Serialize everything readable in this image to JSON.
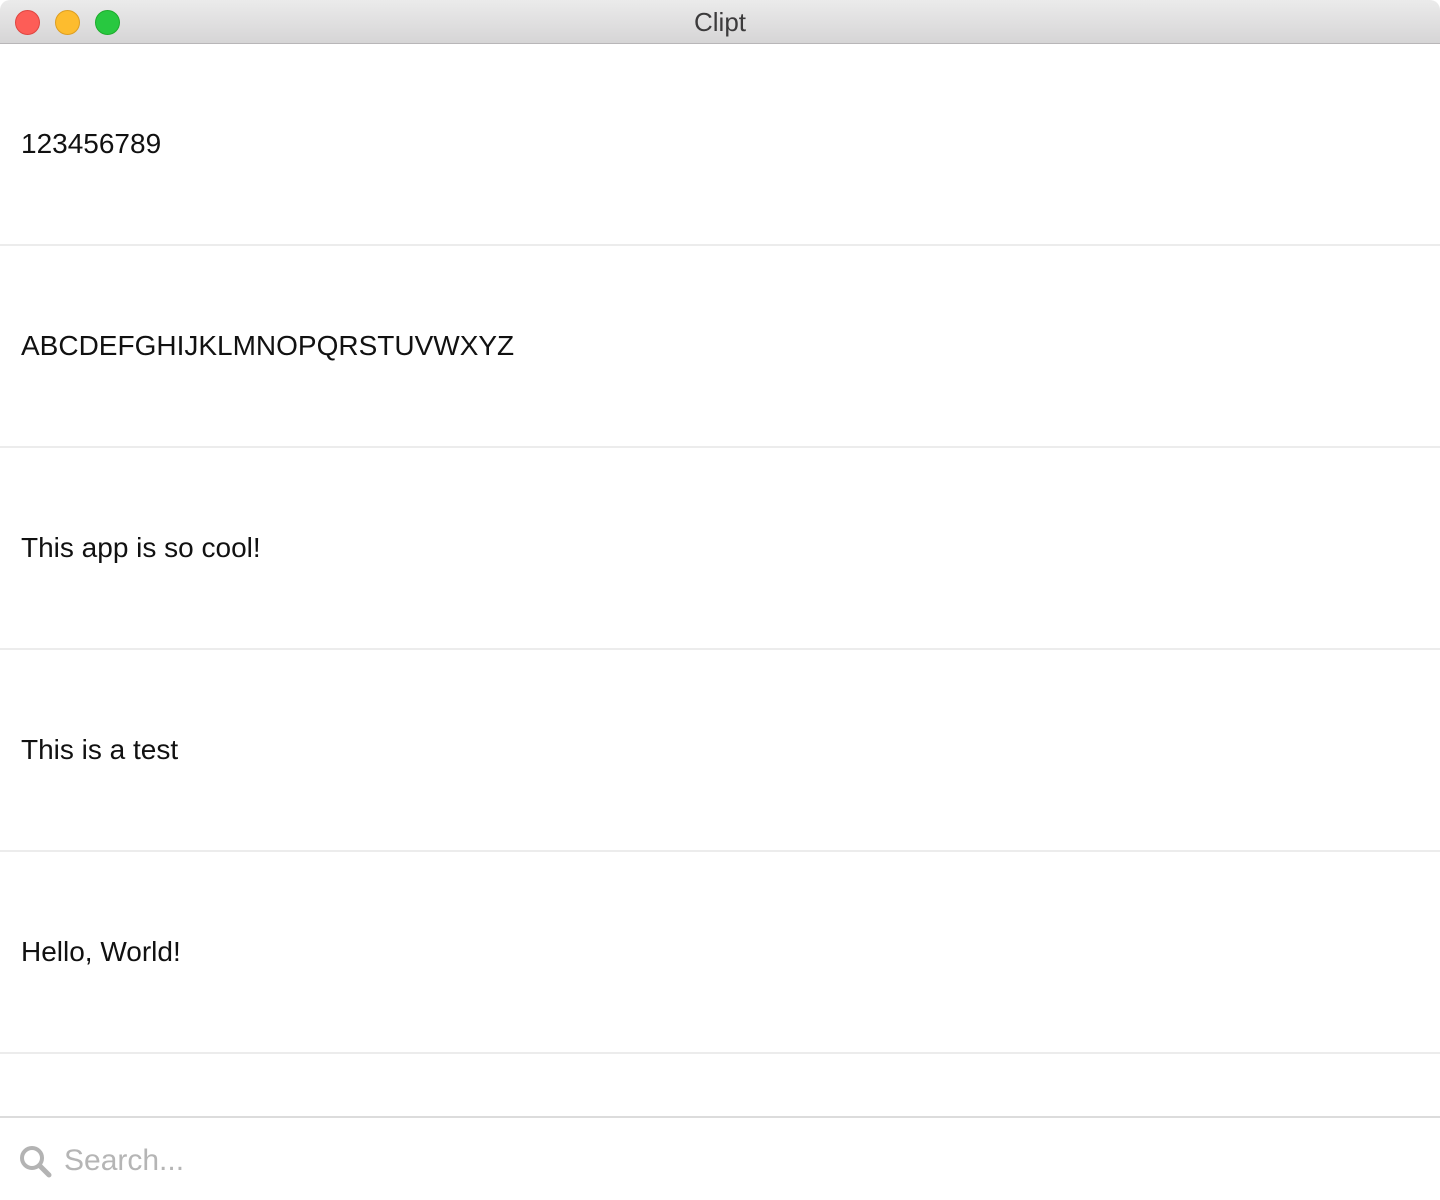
{
  "window": {
    "title": "Clipt"
  },
  "clips": [
    {
      "text": "123456789"
    },
    {
      "text": "ABCDEFGHIJKLMNOPQRSTUVWXYZ"
    },
    {
      "text": "This app is so cool!"
    },
    {
      "text": "This is a test"
    },
    {
      "text": "Hello, World!"
    },
    {
      "text": ""
    }
  ],
  "search": {
    "placeholder": "Search...",
    "value": "",
    "icon": "search-icon"
  },
  "colors": {
    "close": "#fd5d57",
    "minimize": "#fdbc2e",
    "zoom": "#28c840",
    "placeholder": "#b5b5b5"
  }
}
